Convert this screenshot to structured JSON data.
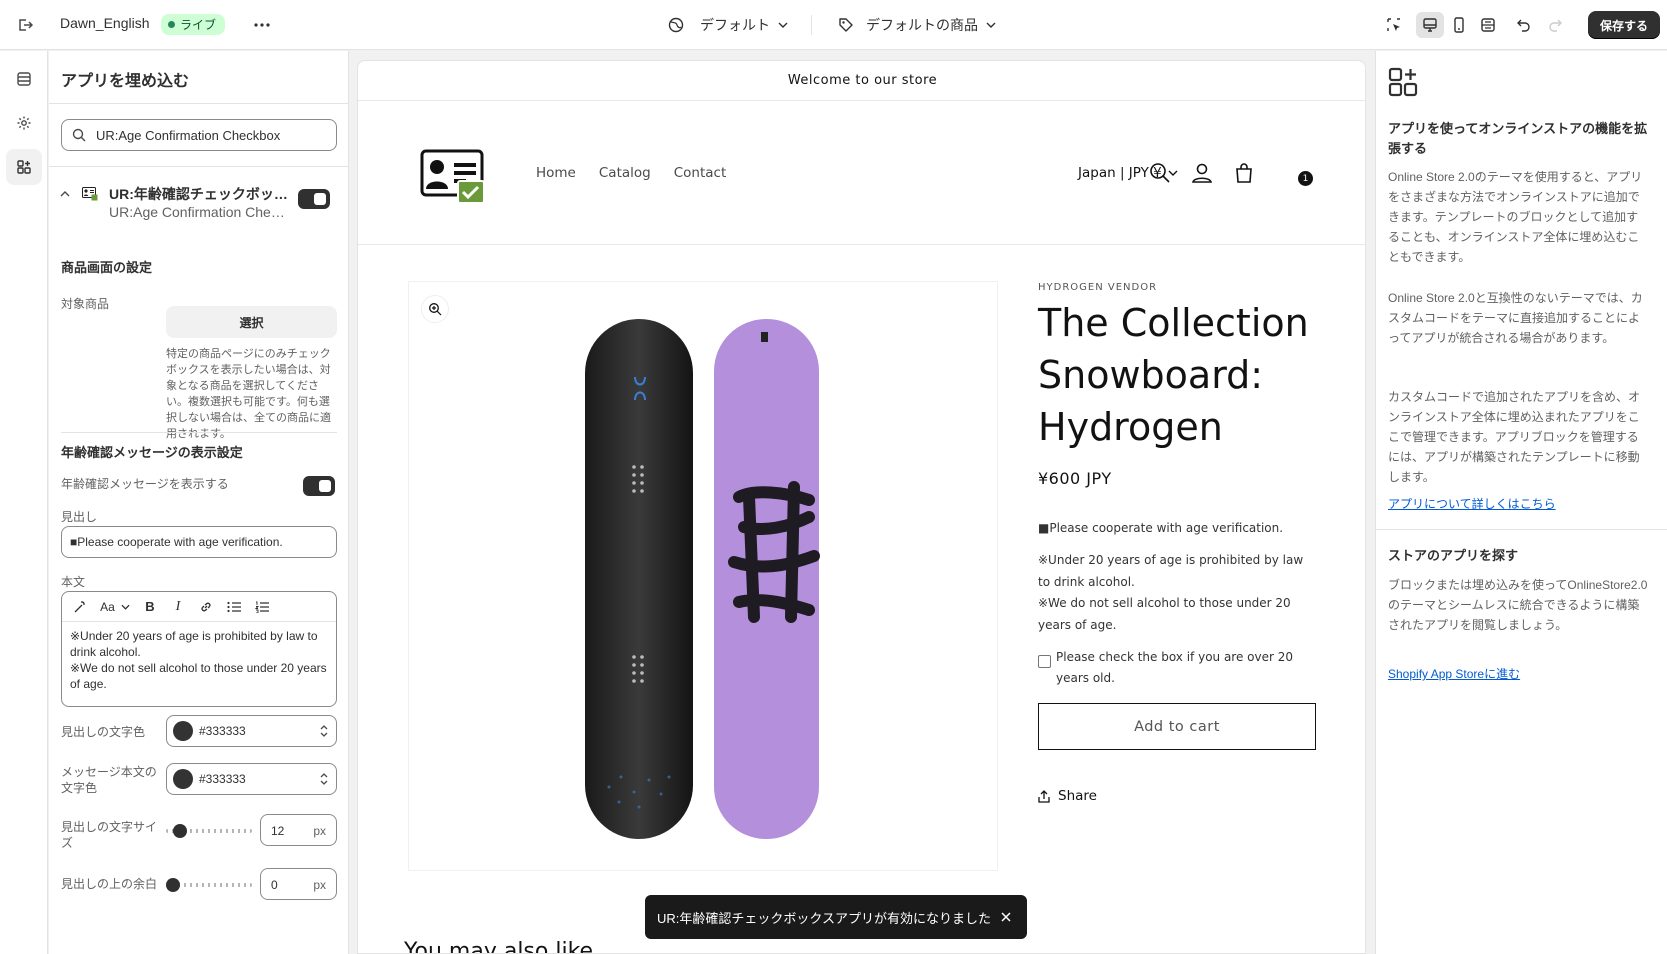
{
  "topbar": {
    "theme_name": "Dawn_English",
    "live_badge": "ライブ",
    "template_dropdown": "デフォルト",
    "product_dropdown": "デフォルトの商品",
    "save_label": "保存する"
  },
  "left_panel": {
    "title": "アプリを埋め込む",
    "search_value": "UR:Age Confirmation Checkbox",
    "app": {
      "name": "UR:年齢確認チェックボックスアプリ",
      "subtitle": "UR:Age Confirmation Checkbox"
    },
    "product_settings": {
      "title": "商品画面の設定",
      "target_label": "対象商品",
      "select_label": "選択",
      "help": "特定の商品ページにのみチェックボックスを表示したい場合は、対象となる商品を選択してください。複数選択も可能です。何も選択しない場合は、全ての商品に適用されます。"
    },
    "message_settings": {
      "title": "年齢確認メッセージの表示設定",
      "show_label": "年齢確認メッセージを表示する",
      "heading_label": "見出し",
      "heading_value": "■Please cooperate with age verification.",
      "body_label": "本文",
      "body_line1": "※Under 20 years of age is prohibited by law to drink alcohol.",
      "body_line2": "※We do not sell alcohol to those under 20 years of age.",
      "font_label": "Aa",
      "heading_color_label": "見出しの文字色",
      "heading_color_value": "#333333",
      "body_color_label": "メッセージ本文の文字色",
      "body_color_value": "#333333",
      "heading_size_label": "見出しの文字サイズ",
      "heading_size_value": "12",
      "heading_size_unit": "px",
      "heading_size_level": 0.1,
      "top_margin_label": "見出しの上の余白",
      "top_margin_value": "0",
      "top_margin_unit": "px",
      "top_margin_level": 0
    }
  },
  "preview": {
    "announcement": "Welcome to our store",
    "nav": [
      "Home",
      "Catalog",
      "Contact"
    ],
    "locale": "Japan | JPY ¥",
    "cart_count": "1",
    "vendor": "HYDROGEN VENDOR",
    "title": "The Collection Snowboard: Hydrogen",
    "price": "¥600 JPY",
    "age_heading": "■Please cooperate with age verification.",
    "age_line1": "※Under 20 years of age is prohibited by law to drink alcohol.",
    "age_line2": "※We do not sell alcohol to those under 20 years of age.",
    "age_checkbox": "Please check the box if you are over 20 years old.",
    "add_to_cart": "Add to cart",
    "share": "Share",
    "bottom_peek": "You may also like"
  },
  "toast": {
    "message": "UR:年齢確認チェックボックスアプリが有効になりました"
  },
  "right_panel": {
    "title": "アプリを使ってオンラインストアの機能を拡張する",
    "p1": "Online Store 2.0のテーマを使用すると、アプリをさまざまな方法でオンラインストアに追加できます。テンプレートのブロックとして追加することも、オンラインストア全体に埋め込むこともできます。",
    "p2": "Online Store 2.0と互換性のないテーマでは、カスタムコードをテーマに直接追加することによってアプリが統合される場合があります。",
    "p3": "カスタムコードで追加されたアプリを含め、オンラインストア全体に埋め込まれたアプリをここで管理できます。アプリブロックを管理するには、アプリが構築されたテンプレートに移動します。",
    "link1": "アプリについて詳しくはこちら",
    "section2_title": "ストアのアプリを探す",
    "p4": "ブロックまたは埋め込みを使ってOnlineStore2.0のテーマとシームレスに統合できるように構築されたアプリを閲覧しましょう。",
    "link2": "Shopify App Storeに進む"
  },
  "colors": {
    "accent_dark": "#303030",
    "live_badge_bg": "#cdfed4",
    "link": "#005bd3",
    "snowboard_purple": "#b48fdc"
  }
}
